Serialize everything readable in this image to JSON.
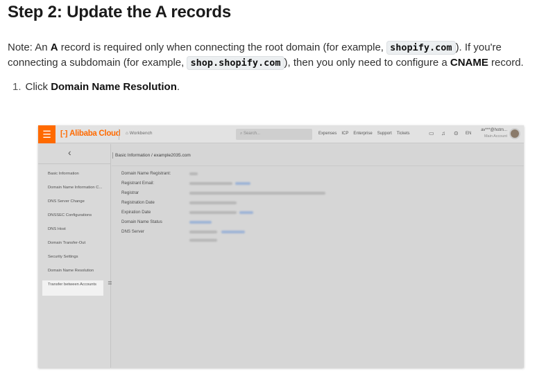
{
  "title": "Step 2: Update the A records",
  "note": {
    "t1": "Note: An ",
    "b1": "A",
    "t2": " record is required only when connecting the root domain (for example, ",
    "code1": "shopify.com",
    "t3": "). If you're connecting a subdomain (for example, ",
    "code2": "shop.shopify.com",
    "t4": "), then you only need to configure a ",
    "b2": "CNAME",
    "t5": " record."
  },
  "step": {
    "number": "1.",
    "text": "Click ",
    "bold": "Domain Name Resolution",
    "end": "."
  },
  "console": {
    "brand": "Alibaba Cloud",
    "workbench": "Workbench",
    "search_placeholder": "Search...",
    "topnav": [
      "Expenses",
      "ICP",
      "Enterprise",
      "Support",
      "Tickets"
    ],
    "language": "EN",
    "account_name": "av***@hotm...",
    "account_sub": "Main Account",
    "sidebar": [
      "Basic Information",
      "Domain Name Information C...",
      "DNS Server Change",
      "DNSSEC Configurations",
      "DNS Host",
      "Domain Transfer-Out",
      "Security Settings",
      "Domain Name Resolution",
      "Transfer between Accounts"
    ],
    "breadcrumb": "Basic Information / example2035.com",
    "fields": [
      "Domain Name Registrant:",
      "Registrant Email:",
      "Registrar",
      "Registration Date",
      "Expiration Date",
      "Domain Name Status",
      "DNS Server"
    ]
  },
  "colors": {
    "brand_orange": "#ff6a00",
    "link_blue": "#9db3d6"
  },
  "icons": [
    "menu-icon",
    "alibaba-logo-icon",
    "home-icon",
    "search-icon",
    "message-icon",
    "bell-icon",
    "help-icon",
    "back-chevron-icon",
    "drag-handle-icon"
  ]
}
